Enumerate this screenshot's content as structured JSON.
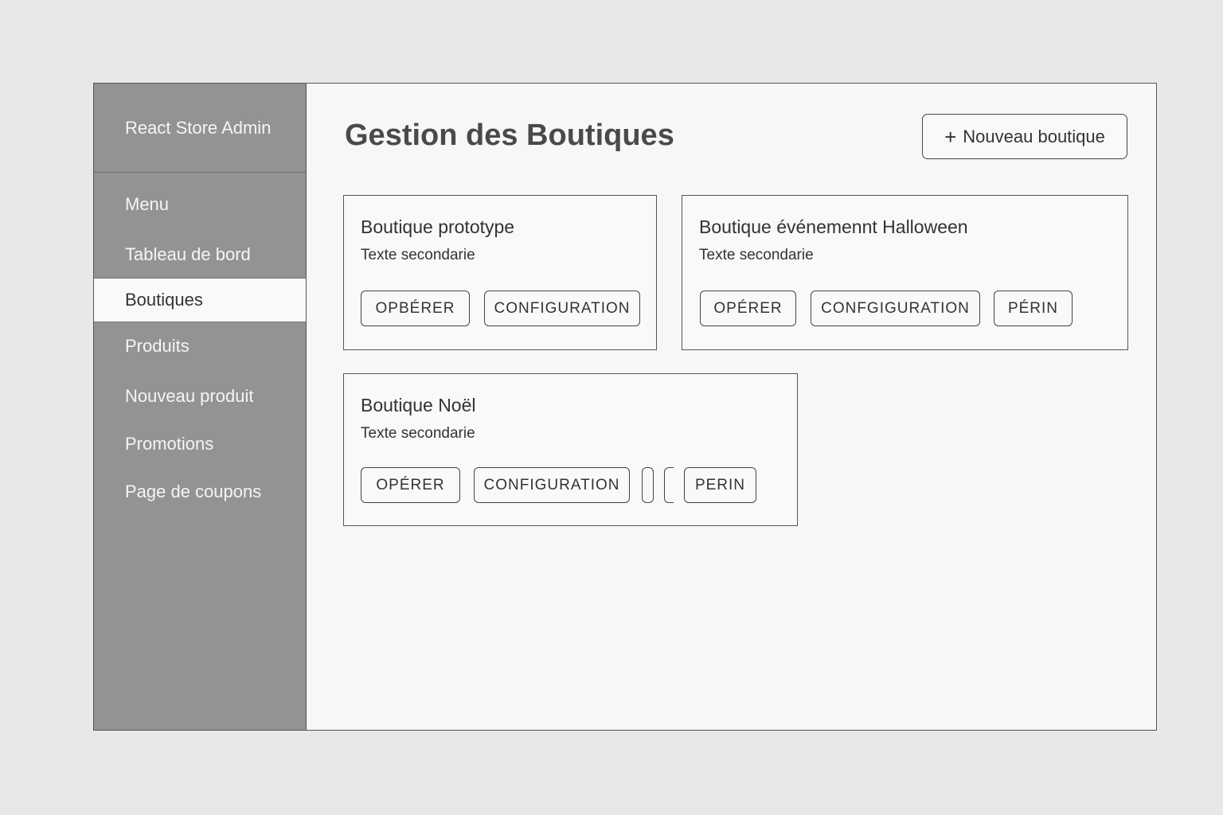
{
  "app": {
    "brand": "React Store Admin"
  },
  "sidebar": {
    "items": [
      {
        "label": "Menu"
      },
      {
        "label": "Tableau de bord"
      },
      {
        "label": "Boutiques"
      },
      {
        "label": "Produits"
      },
      {
        "label": "Nouveau produit"
      },
      {
        "label": "Promotions"
      },
      {
        "label": "Page de coupons"
      }
    ],
    "active": "Boutiques"
  },
  "header": {
    "title": "Gestion des Boutiques",
    "new_button_plus": "+",
    "new_button_label": "Nouveau boutique"
  },
  "cards": [
    {
      "title": "Boutique prototype",
      "subtitle": "Texte secondarie",
      "buttons": [
        "OPBÉRER",
        "CONFIGURATION"
      ]
    },
    {
      "title": "Boutique événemennt Halloween",
      "subtitle": "Texte secondarie",
      "buttons": [
        "OPÉRER",
        "CONFGIGURATION",
        "PÉRIN"
      ]
    },
    {
      "title": "Boutique Noël",
      "subtitle": "Texte secondarie",
      "buttons": [
        "OPÉRER",
        "CONFIGURATION",
        "",
        "",
        "PERIN"
      ]
    }
  ]
}
